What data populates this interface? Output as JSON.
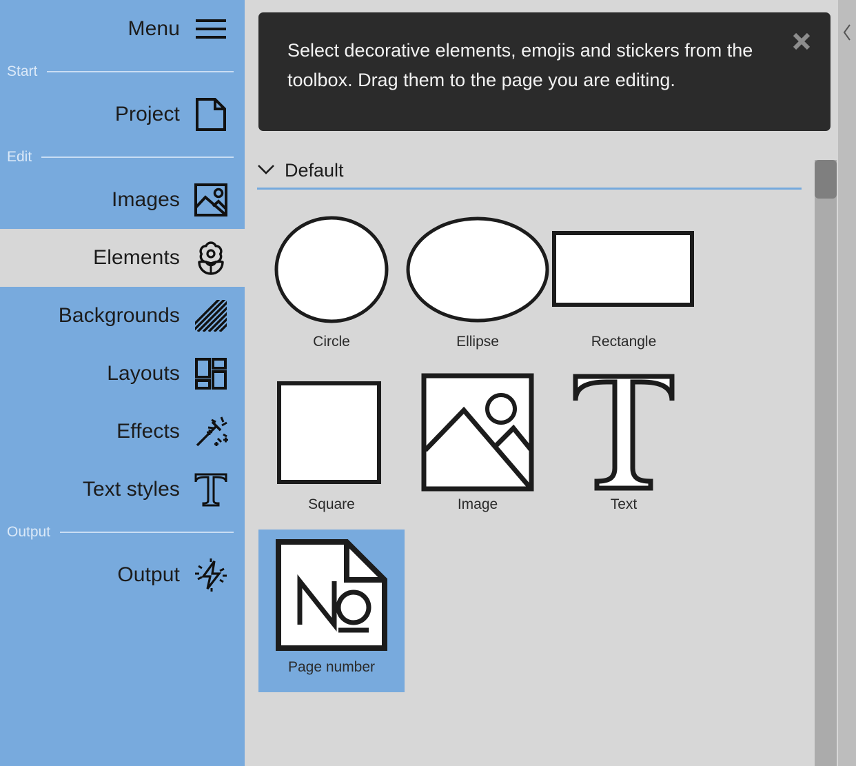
{
  "colors": {
    "sidebar_bg": "#78aadd",
    "selected_nav_bg": "#d7d7d7",
    "main_bg": "#d7d7d7",
    "tooltip_bg": "#2b2b2b",
    "accent_underline": "#74a9dd",
    "tile_selected_bg": "#78aadd",
    "scrollbar_track": "#ababab",
    "scrollbar_thumb": "#7f7f7f",
    "section_label": "#dbe9f8",
    "ink": "#1c1c1c"
  },
  "sidebar": {
    "menu": {
      "label": "Menu",
      "icon": "hamburger-icon"
    },
    "sections": [
      {
        "label": "Start",
        "items": [
          {
            "label": "Project",
            "icon": "document-icon",
            "selected": false
          }
        ]
      },
      {
        "label": "Edit",
        "items": [
          {
            "label": "Images",
            "icon": "picture-icon",
            "selected": false
          },
          {
            "label": "Elements",
            "icon": "flower-icon",
            "selected": true
          },
          {
            "label": "Backgrounds",
            "icon": "hatch-pattern-icon",
            "selected": false
          },
          {
            "label": "Layouts",
            "icon": "layout-grid-icon",
            "selected": false
          },
          {
            "label": "Effects",
            "icon": "magic-wand-icon",
            "selected": false
          },
          {
            "label": "Text styles",
            "icon": "serif-t-icon",
            "selected": false
          }
        ]
      },
      {
        "label": "Output",
        "items": [
          {
            "label": "Output",
            "icon": "lightning-burst-icon",
            "selected": false
          }
        ]
      }
    ]
  },
  "tooltip": {
    "text": "Select decorative elements, emojis and stickers from the toolbox. Drag them to the page you are editing.",
    "close_icon": "close-icon"
  },
  "group": {
    "label": "Default",
    "expanded": true,
    "chevron_icon": "chevron-down-icon"
  },
  "tiles": [
    {
      "label": "Circle",
      "art": "circle-shape",
      "selected": false
    },
    {
      "label": "Ellipse",
      "art": "ellipse-shape",
      "selected": false
    },
    {
      "label": "Rectangle",
      "art": "rectangle-shape",
      "selected": false
    },
    {
      "label": "Square",
      "art": "square-shape",
      "selected": false
    },
    {
      "label": "Image",
      "art": "image-placeholder-shape",
      "selected": false
    },
    {
      "label": "Text",
      "art": "text-serif-t-shape",
      "selected": false
    },
    {
      "label": "Page number",
      "art": "page-number-shape",
      "selected": true
    }
  ],
  "scrollbar": {
    "orientation": "vertical",
    "thumb_position_percent": 0
  },
  "collapse_handle": {
    "icon": "chevron-left-icon"
  }
}
